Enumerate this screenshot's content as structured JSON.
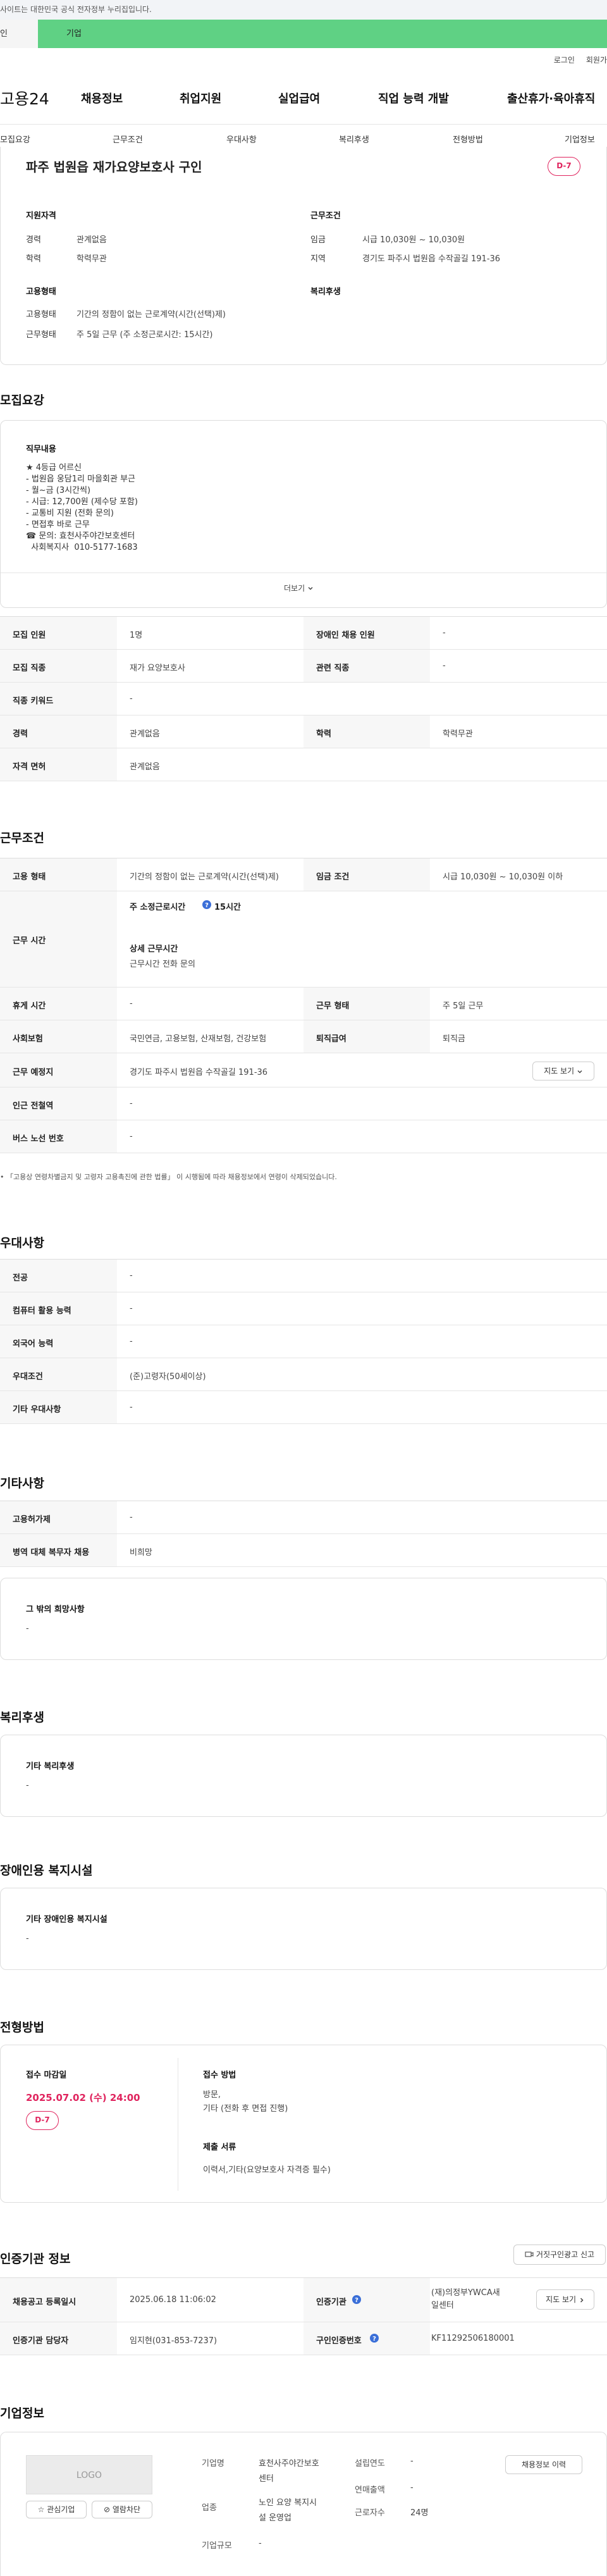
{
  "banner": {
    "text": "사이트는 대한민국 공식 전자정부 누리집입니다."
  },
  "usertype": {
    "personal": "인",
    "company": "기업"
  },
  "util": {
    "login": "로그인",
    "join": "회원가"
  },
  "gnb": {
    "logo": "고용24",
    "menus": [
      "채용정보",
      "취업지원",
      "실업급여",
      "직업 능력 개발",
      "출산휴가·육아휴직"
    ]
  },
  "subnav": [
    "모집요강",
    "근무조건",
    "우대사항",
    "복리후생",
    "전형방법",
    "기업정보"
  ],
  "job": {
    "title": "파주 법원읍 재가요양보호사 구인",
    "dday": "D-7",
    "qual_heading": "지원자격",
    "career_label": "경력",
    "career_value": "관계없음",
    "edu_label": "학력",
    "edu_value": "학력무관",
    "cond_heading": "근무조건",
    "wage_label": "임금",
    "wage_value": "시급 10,030원 ~ 10,030원",
    "area_label": "지역",
    "area_value": "경기도 파주시 법원읍 수작골길 191-36",
    "type_heading": "고용형태",
    "emptype_label": "고용형태",
    "emptype_value": "기간의 정함이 없는 근로계약(시간(선택)제)",
    "worktype_label": "근무형태",
    "worktype_value": "주 5일 근무 (주 소정근로시간: 15시간)",
    "welfare_heading": "복리후생"
  },
  "recruit": {
    "heading": "모집요강",
    "duty_heading": "직무내용",
    "duty_text": "★ 4등급 어르신\n- 법원읍 웅담1리 마을회관 부근\n- 월~금 (3시간씩)\n- 시급: 12,700원 (제수당 포함)\n- 교통비 지원 (전화 문의)\n- 면접후 바로 근무\n☎ 문의: 효천사주야간보호센터\n  사회복지사  010-5177-1683",
    "more": "더보기",
    "rows": [
      {
        "t1": "모집 인원",
        "v1": "1명",
        "t2": "장애인 채용 인원",
        "v2": "-"
      },
      {
        "t1": "모집 직종",
        "v1": "재가 요양보호사",
        "t2": "관련 직종",
        "v2": "-"
      },
      {
        "t1": "직종 키워드",
        "v1": "-"
      },
      {
        "t1": "경력",
        "v1": "관계없음",
        "t2": "학력",
        "v2": "학력무관"
      },
      {
        "t1": "자격 면허",
        "v1": "관계없음"
      }
    ]
  },
  "work": {
    "heading": "근무조건",
    "emp_label": "고용 형태",
    "emp_value": "기간의 정함이 없는 근로계약(시간(선택)제)",
    "wage_label": "임금 조건",
    "wage_value": "시급 10,030원 ~ 10,030원 이하",
    "time_label": "근무 시간",
    "weekly_label": "주 소정근로시간",
    "weekly_value": "15시간",
    "detail_label": "상세 근무시간",
    "detail_value": "근무시간 전화 문의",
    "rest_label": "휴게 시간",
    "rest_value": "-",
    "form_label": "근무 형태",
    "form_value": "주 5일 근무",
    "ins_label": "사회보험",
    "ins_value": "국민연금, 고용보험, 산재보험, 건강보험",
    "sev_label": "퇴직급여",
    "sev_value": "퇴직금",
    "place_label": "근무 예정지",
    "place_value": "경기도 파주시 법원읍 수작골길 191-36",
    "map_btn": "지도 보기",
    "station_label": "인근 전철역",
    "station_value": "-",
    "bus_label": "버스 노선 번호",
    "bus_value": "-",
    "note": "「고용상 연령차별금지 및 고령자 고용촉진에 관한 법률」 이 시행됨에 따라 채용정보에서 연령이 삭제되었습니다."
  },
  "pref": {
    "heading": "우대사항",
    "rows": [
      {
        "t": "전공",
        "v": "-"
      },
      {
        "t": "컴퓨터 활용 능력",
        "v": "-"
      },
      {
        "t": "외국어 능력",
        "v": "-"
      },
      {
        "t": "우대조건",
        "v": "(준)고령자(50세이상)"
      },
      {
        "t": "기타 우대사항",
        "v": "-"
      }
    ]
  },
  "etc": {
    "heading": "기타사항",
    "rows": [
      {
        "t": "고용허가제",
        "v": "-"
      },
      {
        "t": "병역 대체 복무자 채용",
        "v": "비희망"
      }
    ],
    "hope_heading": "그 밖의 희망사항",
    "hope_value": "-"
  },
  "welfare": {
    "heading": "복리후생",
    "box_heading": "기타 복리후생",
    "box_value": "-"
  },
  "disabled": {
    "heading": "장애인용 복지시설",
    "box_heading": "기타 장애인용 복지시설",
    "box_value": "-"
  },
  "selection": {
    "heading": "전형방법",
    "deadline_label": "접수 마감일",
    "deadline_value": "2025.07.02 (수) 24:00",
    "dday": "D-7",
    "method_label": "접수 방법",
    "method_value": "방문,\n기타 (전화 후 면접 진행)",
    "docs_label": "제출 서류",
    "docs_value": "이력서,기타(요양보호사 자격증 필수)"
  },
  "cert": {
    "heading": "인증기관 정보",
    "report_btn": "거짓구인광고 신고",
    "reg_label": "채용공고 등록일시",
    "reg_value": "2025.06.18 11:06:02",
    "org_label": "인증기관",
    "org_value": "(재)의정부YWCA새일센터",
    "map_btn": "지도 보기",
    "mgr_label": "인증기관 담당자",
    "mgr_value": "임지현(031-853-7237)",
    "no_label": "구인인증번호",
    "no_value": "KF11292506180001"
  },
  "company": {
    "heading": "기업정보",
    "logo_text": "LOGO",
    "fav_btn": "관심기업",
    "block_btn": "열람차단",
    "name_label": "기업명",
    "name_value": "효천사주야간보호\n센터",
    "found_label": "설립연도",
    "found_value": "-",
    "industry_label": "업종",
    "industry_value": "노인 요양 복지시\n설 운영업",
    "sales_label": "연매출액",
    "sales_value": "-",
    "emp_label": "근로자수",
    "emp_value": "24명",
    "size_label": "기업규모",
    "size_value": "-",
    "history_btn": "채용정보 이력"
  }
}
